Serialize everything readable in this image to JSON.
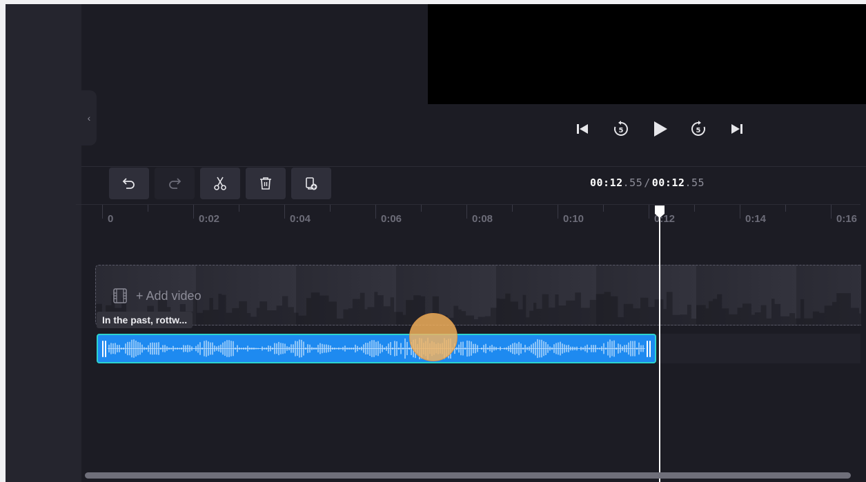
{
  "transport": {
    "buttons": [
      "skip-to-start",
      "rewind-5",
      "play",
      "forward-5",
      "skip-to-end"
    ]
  },
  "toolbar": {
    "tools": [
      "undo",
      "redo",
      "split",
      "delete",
      "duplicate"
    ]
  },
  "timecode": {
    "current_main": "00:12",
    "current_frac": ".55",
    "separator": "/",
    "total_main": "00:12",
    "total_frac": ".55"
  },
  "ruler": {
    "labels": [
      "0",
      "0:02",
      "0:04",
      "0:06",
      "0:08",
      "0:10",
      "0:12",
      "0:14",
      "0:16"
    ]
  },
  "video_track": {
    "add_label": "+ Add video"
  },
  "audio_track": {
    "clip_label": "In the past, rottw..."
  },
  "colors": {
    "background": "#1c1c24",
    "audio_fill": "#1e8af0",
    "audio_border": "#2dd4cf",
    "cursor": "#f5b25c"
  }
}
